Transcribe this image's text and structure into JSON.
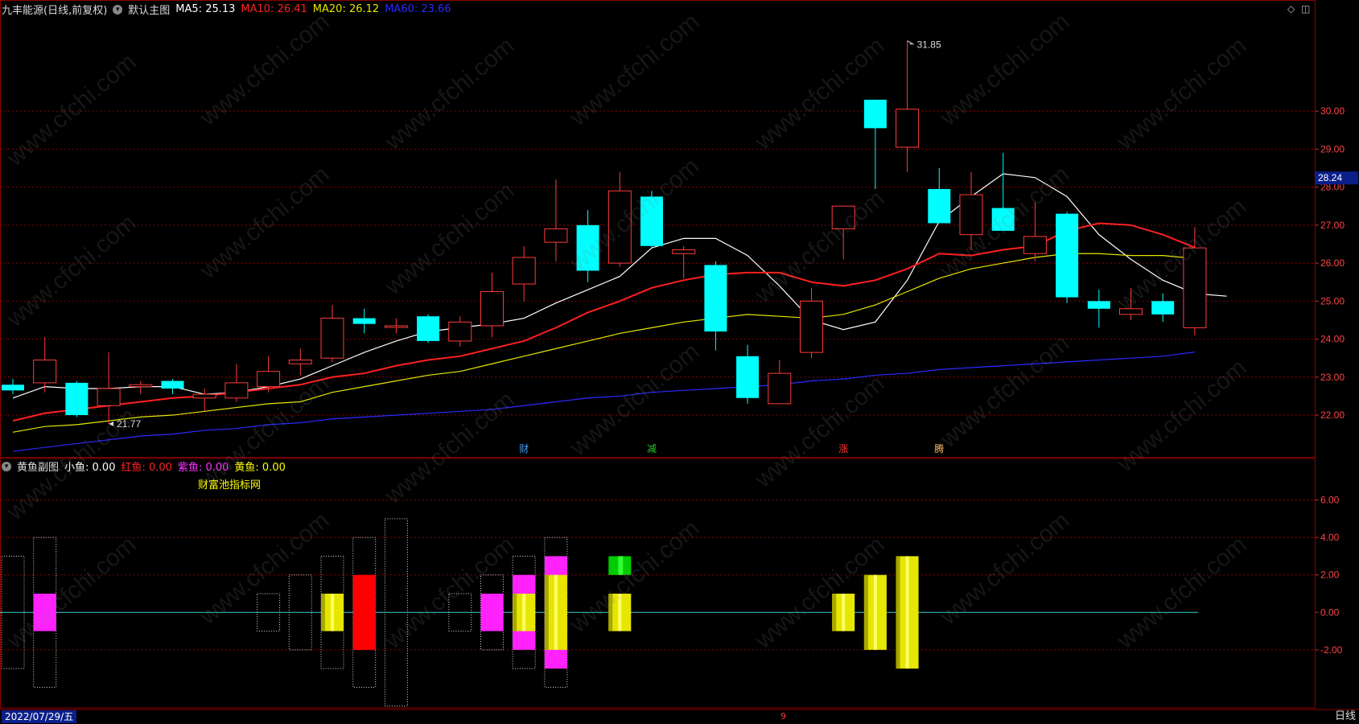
{
  "header": {
    "stock_name": "九丰能源(日线,前复权)",
    "main_chart_name": "默认主图",
    "ma": [
      {
        "label": "MA5: 25.13",
        "color": "#ffffff"
      },
      {
        "label": "MA10: 26.41",
        "color": "#ff2020"
      },
      {
        "label": "MA20: 26.12",
        "color": "#e6e600"
      },
      {
        "label": "MA60: 23.66",
        "color": "#2a2aff"
      }
    ]
  },
  "sub_header": {
    "name": "黄鱼副图",
    "items": [
      {
        "label": "小鱼: 0.00",
        "color": "#ffffff"
      },
      {
        "label": "红鱼: 0.00",
        "color": "#ff2020"
      },
      {
        "label": "紫鱼: 0.00",
        "color": "#ff33ff"
      },
      {
        "label": "黄鱼: 0.00",
        "color": "#ffff00"
      }
    ],
    "caption": "财富池指标网"
  },
  "watermark_text": "www.cfchi.com",
  "footer": {
    "date": "2022/07/29/五",
    "month_marker": "9",
    "period": "日线"
  },
  "chart_data": [
    {
      "type": "candlestick",
      "title": "九丰能源(日线,前复权)",
      "y_ticks": [
        22.0,
        23.0,
        24.0,
        25.0,
        26.0,
        27.0,
        28.0,
        29.0,
        30.0
      ],
      "ylim": [
        20.9,
        32.5
      ],
      "last_price": "28.24",
      "annotations": [
        {
          "text": "31.85",
          "bar": 28,
          "value": 31.85,
          "kind": "high"
        },
        {
          "text": "21.77",
          "bar": 3,
          "value": 21.77,
          "kind": "low"
        }
      ],
      "event_markers": [
        {
          "text": "财",
          "bar": 16,
          "color": "#3fa0ff"
        },
        {
          "text": "减",
          "bar": 20,
          "color": "#22cc22"
        },
        {
          "text": "涨",
          "bar": 26,
          "color": "#ff3333"
        },
        {
          "text": "腾",
          "bar": 29,
          "color": "#ffbb66"
        }
      ],
      "candles": [
        {
          "o": 22.8,
          "h": 22.95,
          "l": 22.55,
          "c": 22.65
        },
        {
          "o": 22.85,
          "h": 24.05,
          "l": 22.6,
          "c": 23.45
        },
        {
          "o": 22.85,
          "h": 22.9,
          "l": 21.95,
          "c": 22.0
        },
        {
          "o": 22.25,
          "h": 23.65,
          "l": 21.77,
          "c": 22.7
        },
        {
          "o": 22.75,
          "h": 22.9,
          "l": 22.55,
          "c": 22.8
        },
        {
          "o": 22.9,
          "h": 22.95,
          "l": 22.55,
          "c": 22.7
        },
        {
          "o": 22.45,
          "h": 22.7,
          "l": 22.1,
          "c": 22.55
        },
        {
          "o": 22.45,
          "h": 23.35,
          "l": 22.35,
          "c": 22.85
        },
        {
          "o": 22.75,
          "h": 23.55,
          "l": 22.6,
          "c": 23.15
        },
        {
          "o": 23.35,
          "h": 23.75,
          "l": 23.05,
          "c": 23.45
        },
        {
          "o": 23.5,
          "h": 24.9,
          "l": 23.4,
          "c": 24.55
        },
        {
          "o": 24.55,
          "h": 24.8,
          "l": 24.15,
          "c": 24.4
        },
        {
          "o": 24.35,
          "h": 24.55,
          "l": 24.15,
          "c": 24.35
        },
        {
          "o": 24.6,
          "h": 24.65,
          "l": 23.9,
          "c": 23.95
        },
        {
          "o": 23.95,
          "h": 24.6,
          "l": 23.8,
          "c": 24.45
        },
        {
          "o": 24.35,
          "h": 25.75,
          "l": 24.05,
          "c": 25.25
        },
        {
          "o": 25.45,
          "h": 26.45,
          "l": 25.0,
          "c": 26.15
        },
        {
          "o": 26.55,
          "h": 28.2,
          "l": 26.05,
          "c": 26.9
        },
        {
          "o": 27.0,
          "h": 27.4,
          "l": 25.5,
          "c": 25.8
        },
        {
          "o": 26.0,
          "h": 28.4,
          "l": 25.9,
          "c": 27.9
        },
        {
          "o": 27.75,
          "h": 27.9,
          "l": 26.4,
          "c": 26.45
        },
        {
          "o": 26.25,
          "h": 26.45,
          "l": 25.6,
          "c": 26.35
        },
        {
          "o": 25.95,
          "h": 26.05,
          "l": 23.7,
          "c": 24.2
        },
        {
          "o": 23.55,
          "h": 23.85,
          "l": 22.3,
          "c": 22.45
        },
        {
          "o": 22.3,
          "h": 23.45,
          "l": 22.3,
          "c": 23.1
        },
        {
          "o": 23.65,
          "h": 25.35,
          "l": 23.5,
          "c": 25.0
        },
        {
          "o": 26.9,
          "h": 27.45,
          "l": 26.1,
          "c": 27.5
        },
        {
          "o": 30.3,
          "h": 30.3,
          "l": 27.95,
          "c": 29.55
        },
        {
          "o": 29.05,
          "h": 31.85,
          "l": 28.4,
          "c": 30.05
        },
        {
          "o": 27.95,
          "h": 28.5,
          "l": 27.05,
          "c": 27.05
        },
        {
          "o": 26.75,
          "h": 28.4,
          "l": 26.35,
          "c": 27.8
        },
        {
          "o": 27.45,
          "h": 28.9,
          "l": 26.85,
          "c": 26.85
        },
        {
          "o": 26.25,
          "h": 27.6,
          "l": 26.05,
          "c": 26.7
        },
        {
          "o": 27.3,
          "h": 27.35,
          "l": 24.95,
          "c": 25.1
        },
        {
          "o": 25.0,
          "h": 25.3,
          "l": 24.3,
          "c": 24.8
        },
        {
          "o": 24.65,
          "h": 25.35,
          "l": 24.5,
          "c": 24.8
        },
        {
          "o": 25.0,
          "h": 25.2,
          "l": 24.45,
          "c": 24.65
        },
        {
          "o": 24.3,
          "h": 26.95,
          "l": 24.1,
          "c": 26.4
        }
      ],
      "ma_lines": [
        {
          "name": "MA5",
          "color": "#ffffff",
          "start": 0,
          "values": [
            22.45,
            22.75,
            22.7,
            22.7,
            22.75,
            22.75,
            22.55,
            22.6,
            22.75,
            22.95,
            23.3,
            23.65,
            23.95,
            24.2,
            24.3,
            24.4,
            24.55,
            24.95,
            25.3,
            25.65,
            26.4,
            26.65,
            26.65,
            26.2,
            25.4,
            24.5,
            24.25,
            24.45,
            25.55,
            27.1,
            27.75,
            28.35,
            28.25,
            27.75,
            26.75,
            26.1,
            25.55,
            25.2,
            25.13
          ]
        },
        {
          "name": "MA10",
          "color": "#ff2020",
          "start": 0,
          "values": [
            21.85,
            22.05,
            22.15,
            22.25,
            22.35,
            22.45,
            22.5,
            22.6,
            22.7,
            22.8,
            23.0,
            23.1,
            23.3,
            23.45,
            23.55,
            23.75,
            23.95,
            24.3,
            24.7,
            25.0,
            25.35,
            25.55,
            25.7,
            25.75,
            25.75,
            25.5,
            25.4,
            25.55,
            25.85,
            26.25,
            26.2,
            26.35,
            26.45,
            26.85,
            27.05,
            27.0,
            26.75,
            26.41
          ]
        },
        {
          "name": "MA20",
          "color": "#e6e600",
          "start": 0,
          "values": [
            21.55,
            21.7,
            21.75,
            21.85,
            21.95,
            22.0,
            22.1,
            22.2,
            22.3,
            22.35,
            22.6,
            22.75,
            22.9,
            23.05,
            23.15,
            23.35,
            23.55,
            23.75,
            23.95,
            24.15,
            24.3,
            24.45,
            24.55,
            24.65,
            24.6,
            24.55,
            24.65,
            24.9,
            25.25,
            25.6,
            25.85,
            26.0,
            26.15,
            26.25,
            26.25,
            26.2,
            26.2,
            26.12
          ]
        },
        {
          "name": "MA60",
          "color": "#2a2aff",
          "start": 0,
          "values": [
            21.05,
            21.15,
            21.25,
            21.35,
            21.45,
            21.5,
            21.6,
            21.65,
            21.75,
            21.8,
            21.9,
            21.95,
            22.0,
            22.05,
            22.1,
            22.15,
            22.25,
            22.35,
            22.45,
            22.5,
            22.6,
            22.65,
            22.7,
            22.75,
            22.8,
            22.9,
            22.95,
            23.05,
            23.1,
            23.2,
            23.25,
            23.3,
            23.35,
            23.4,
            23.45,
            23.5,
            23.55,
            23.66
          ]
        }
      ]
    },
    {
      "type": "bar",
      "title": "黄鱼副图",
      "y_ticks": [
        -2.0,
        0.0,
        2.0,
        4.0,
        6.0
      ],
      "ylim": [
        -5.1,
        8.0
      ],
      "bars": [
        {
          "bar": 0,
          "kind": "box",
          "from": -3,
          "to": 3
        },
        {
          "bar": 1,
          "kind": "box",
          "from": -4,
          "to": 4
        },
        {
          "bar": 1,
          "kind": "purple",
          "from": -1,
          "to": 1
        },
        {
          "bar": 8,
          "kind": "box",
          "from": -1,
          "to": 1
        },
        {
          "bar": 9,
          "kind": "box",
          "from": -2,
          "to": 2
        },
        {
          "bar": 10,
          "kind": "box",
          "from": -3,
          "to": 3
        },
        {
          "bar": 10,
          "kind": "yellow",
          "from": -1,
          "to": 1
        },
        {
          "bar": 11,
          "kind": "box",
          "from": -4,
          "to": 4
        },
        {
          "bar": 11,
          "kind": "red",
          "from": -2,
          "to": 2
        },
        {
          "bar": 12,
          "kind": "box",
          "from": -5,
          "to": 5
        },
        {
          "bar": 14,
          "kind": "box",
          "from": -1,
          "to": 1
        },
        {
          "bar": 15,
          "kind": "box",
          "from": -2,
          "to": 2
        },
        {
          "bar": 15,
          "kind": "purple",
          "from": -1,
          "to": 1
        },
        {
          "bar": 16,
          "kind": "box",
          "from": -3,
          "to": 3
        },
        {
          "bar": 16,
          "kind": "purple",
          "from": -2,
          "to": 2
        },
        {
          "bar": 16,
          "kind": "yellow",
          "from": -1,
          "to": 1
        },
        {
          "bar": 17,
          "kind": "box",
          "from": -4,
          "to": 4
        },
        {
          "bar": 17,
          "kind": "purple",
          "from": -3,
          "to": 3
        },
        {
          "bar": 17,
          "kind": "yellow",
          "from": -2,
          "to": 2
        },
        {
          "bar": 19,
          "kind": "green",
          "from": 2,
          "to": 3
        },
        {
          "bar": 19,
          "kind": "yellow",
          "from": -1,
          "to": 1
        },
        {
          "bar": 26,
          "kind": "yellow",
          "from": -1,
          "to": 1
        },
        {
          "bar": 27,
          "kind": "yellow",
          "from": -2,
          "to": 2
        },
        {
          "bar": 28,
          "kind": "yellow",
          "from": -3,
          "to": 3
        }
      ]
    }
  ]
}
